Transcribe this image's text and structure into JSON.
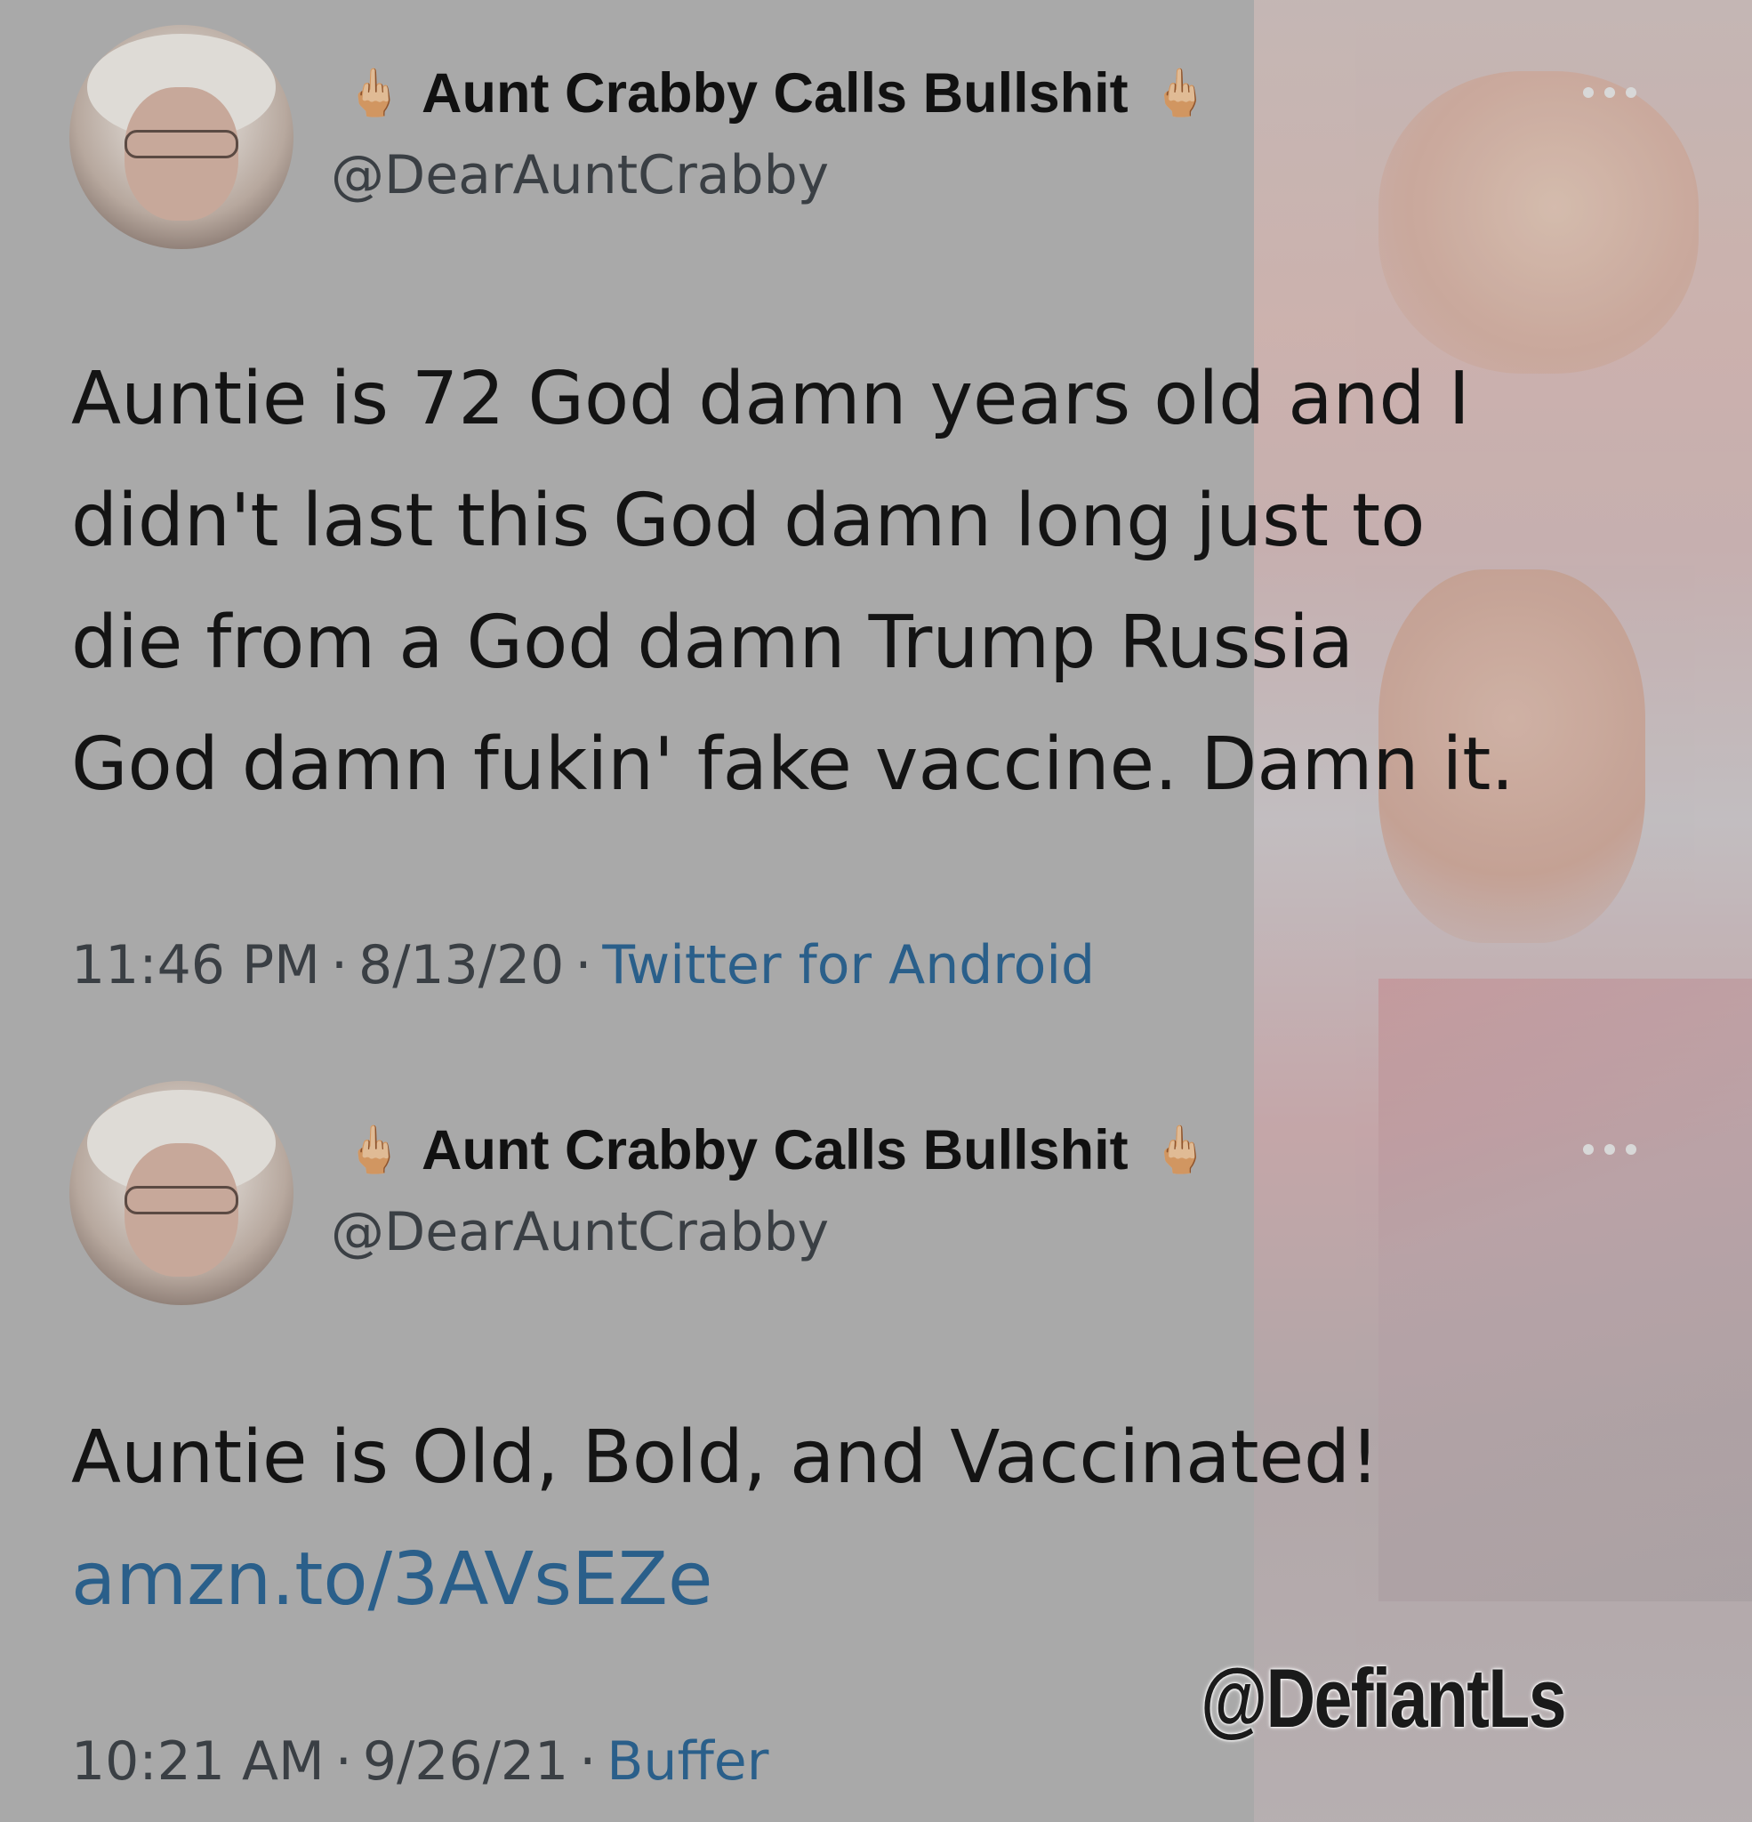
{
  "colors": {
    "background": "#a9a9a9",
    "text": "#141414",
    "secondary_text": "#3a3f44",
    "link": "#2a5f8a"
  },
  "tweets": [
    {
      "avatar": "avatar-elderly-woman",
      "emoji_left": "🖕🏼",
      "display_name": "Aunt Crabby Calls Bullshit",
      "emoji_right": "🖕🏼",
      "handle": "@DearAuntCrabby",
      "more_icon": "ellipsis-icon",
      "text_lines": [
        "Auntie is 72 God damn years old and I",
        "didn't last this God damn long just to",
        "die from a God damn Trump Russia",
        "God damn fukin' fake vaccine. Damn it."
      ],
      "time": "11:46 PM",
      "date": "8/13/20",
      "source": "Twitter for Android"
    },
    {
      "avatar": "avatar-elderly-woman",
      "emoji_left": "🖕🏼",
      "display_name": "Aunt Crabby Calls Bullshit",
      "emoji_right": "🖕🏼",
      "handle": "@DearAuntCrabby",
      "more_icon": "ellipsis-icon",
      "text_lines": [
        "Auntie is Old, Bold, and Vaccinated!"
      ],
      "link": "amzn.to/3AVsEZe",
      "time": "10:21 AM",
      "date": "9/26/21",
      "source": "Buffer"
    }
  ],
  "separator": "·",
  "watermark": "@DefiantLs"
}
